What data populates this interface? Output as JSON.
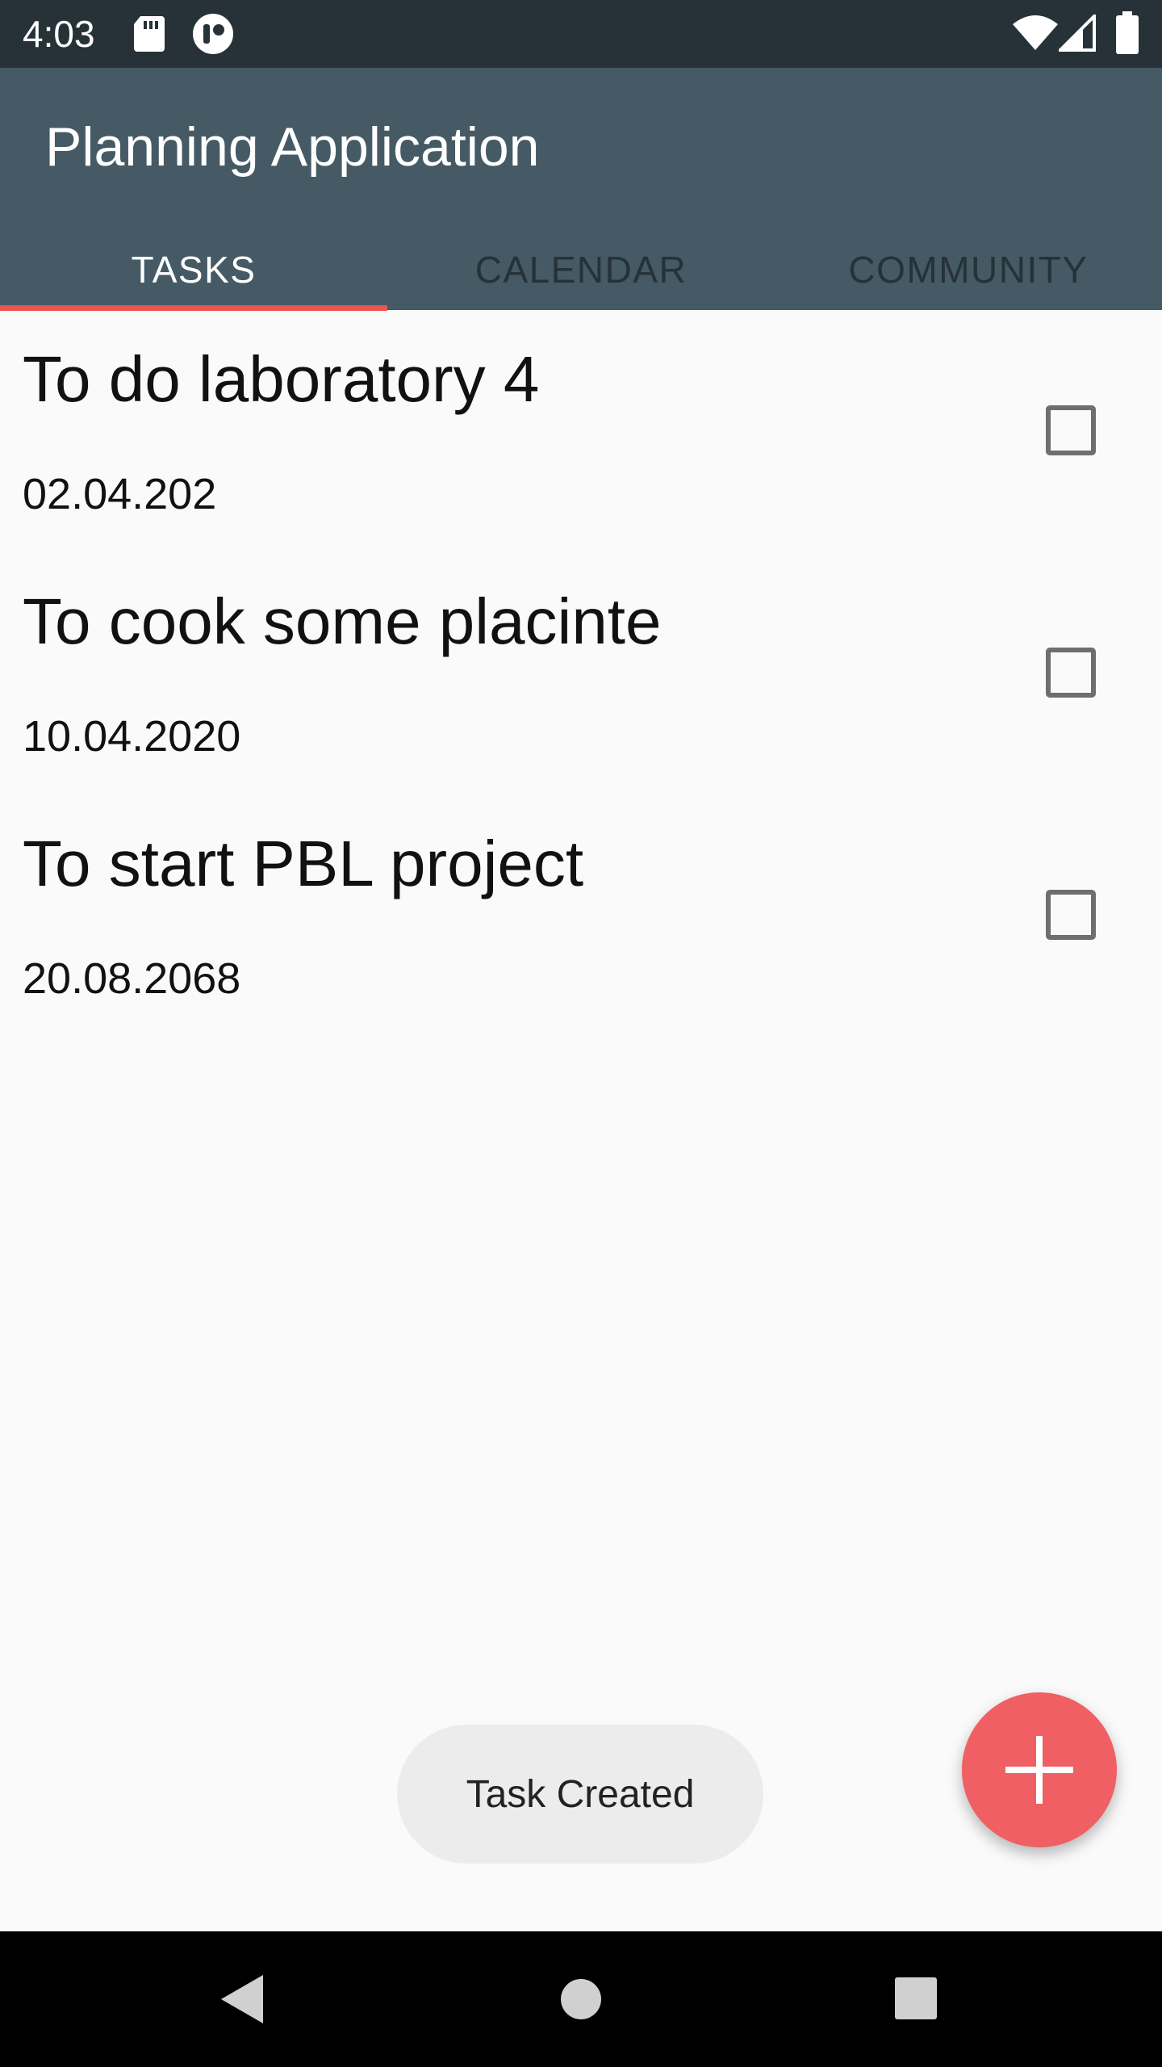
{
  "status_bar": {
    "time": "4:03",
    "left_icons": [
      "sd-card-icon",
      "game-notification-icon"
    ],
    "right_icons": [
      "wifi-icon",
      "signal-icon",
      "battery-icon"
    ]
  },
  "app_bar": {
    "title": "Planning Application",
    "background_color": "#455a64"
  },
  "tabs": [
    {
      "label": "TASKS",
      "active": true
    },
    {
      "label": "CALENDAR",
      "active": false
    },
    {
      "label": "COMMUNITY",
      "active": false
    }
  ],
  "tasks": [
    {
      "title": "To do laboratory 4",
      "date": "02.04.202",
      "checked": false
    },
    {
      "title": "To cook some placinte",
      "date": "10.04.2020",
      "checked": false
    },
    {
      "title": "To start PBL project",
      "date": "20.08.2068",
      "checked": false
    }
  ],
  "toast": {
    "text": "Task Created"
  },
  "fab": {
    "icon": "plus-icon",
    "color": "#ef5f63"
  },
  "nav_bar": {
    "buttons": [
      "back-icon",
      "home-icon",
      "recents-icon"
    ]
  },
  "colors": {
    "accent": "#ef5350",
    "status_bar": "#263238"
  }
}
